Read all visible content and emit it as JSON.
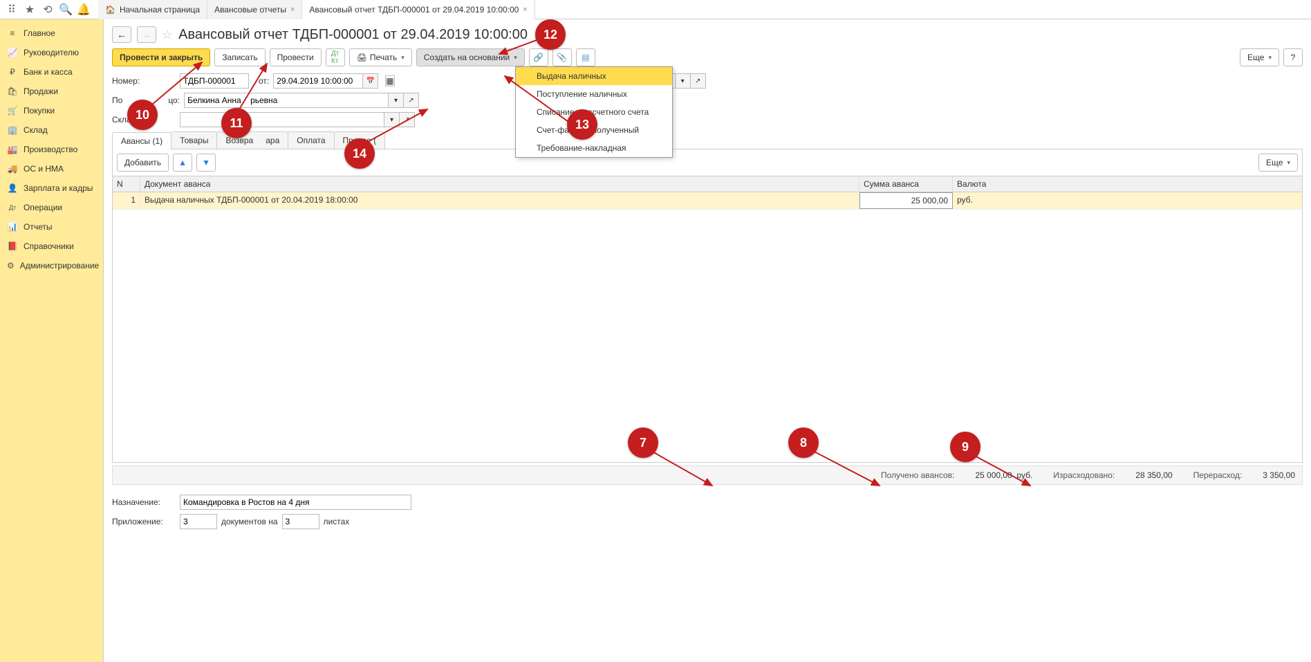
{
  "top_tabs": {
    "home": "Начальная страница",
    "reports": "Авансовые отчеты",
    "current": "Авансовый отчет ТДБП-000001 от 29.04.2019 10:00:00"
  },
  "sidebar": {
    "items": [
      {
        "icon": "≡",
        "label": "Главное"
      },
      {
        "icon": "📈",
        "label": "Руководителю"
      },
      {
        "icon": "₽",
        "label": "Банк и касса"
      },
      {
        "icon": "🛍",
        "label": "Продажи"
      },
      {
        "icon": "🛒",
        "label": "Покупки"
      },
      {
        "icon": "🏢",
        "label": "Склад"
      },
      {
        "icon": "🏭",
        "label": "Производство"
      },
      {
        "icon": "🚚",
        "label": "ОС и НМА"
      },
      {
        "icon": "👤",
        "label": "Зарплата и кадры"
      },
      {
        "icon": "Дт",
        "label": "Операции"
      },
      {
        "icon": "📊",
        "label": "Отчеты"
      },
      {
        "icon": "📕",
        "label": "Справочники"
      },
      {
        "icon": "⚙",
        "label": "Администрирование"
      }
    ]
  },
  "page": {
    "title": "Авансовый отчет ТДБП-000001 от 29.04.2019 10:00:00"
  },
  "toolbar": {
    "post_close": "Провести и закрыть",
    "save": "Записать",
    "post": "Провести",
    "print": "Печать",
    "create_based": "Создать на основании",
    "more": "Еще"
  },
  "create_menu": {
    "items": [
      "Выдача наличных",
      "Поступление наличных",
      "Списание с расчетного счета",
      "Счет-фактура полученный",
      "Требование-накладная"
    ]
  },
  "form": {
    "number_label": "Номер:",
    "number": "ТДБП-000001",
    "from_label": "от:",
    "date": "29.04.2019 10:00:00",
    "person_label_partial": "По",
    "person_label_end": "цо:",
    "person": "Белкина Анна",
    "person_end": "рьевна",
    "warehouse_label": "Склад:",
    "warehouse": "",
    "purpose_label": "Назначение:",
    "purpose": "Командировка в Ростов на 4 дня",
    "attachment_label": "Приложение:",
    "attach_docs": "3",
    "attach_docs_label": "документов на",
    "attach_pages": "3",
    "attach_pages_label": "листах"
  },
  "doc_tabs": {
    "advances": "Авансы (1)",
    "goods": "Товары",
    "return": "Возвра",
    "return_end": "ара",
    "payment": "Оплата",
    "other": "Прочее ("
  },
  "tab_tb": {
    "add": "Добавить",
    "more": "Еще"
  },
  "grid": {
    "headers": {
      "n": "N",
      "doc": "Документ аванса",
      "sum": "Сумма аванса",
      "cur": "Валюта"
    },
    "rows": [
      {
        "n": "1",
        "doc": "Выдача наличных ТДБП-000001 от 20.04.2019 18:00:00",
        "sum": "25 000,00",
        "cur": "руб."
      }
    ]
  },
  "totals": {
    "received_label": "Получено авансов:",
    "received": "25 000,00",
    "received_cur": "руб.",
    "spent_label": "Израсходовано:",
    "spent": "28 350,00",
    "over_label": "Перерасход:",
    "over": "3 350,00"
  },
  "badges": {
    "b7": "7",
    "b8": "8",
    "b9": "9",
    "b10": "10",
    "b11": "11",
    "b12": "12",
    "b13": "13",
    "b14": "14"
  }
}
